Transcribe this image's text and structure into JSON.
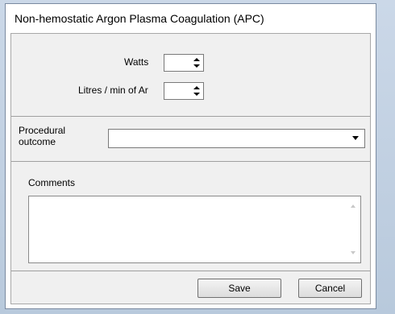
{
  "window": {
    "title": "Non-hemostatic Argon Plasma Coagulation (APC)"
  },
  "settings": {
    "watts_label": "Watts",
    "watts_value": "",
    "flow_label": "Litres / min of Ar",
    "flow_value": ""
  },
  "outcome": {
    "label_line1": "Procedural",
    "label_line2": "outcome",
    "selected": ""
  },
  "comments": {
    "label": "Comments",
    "value": ""
  },
  "buttons": {
    "save": "Save",
    "cancel": "Cancel"
  }
}
